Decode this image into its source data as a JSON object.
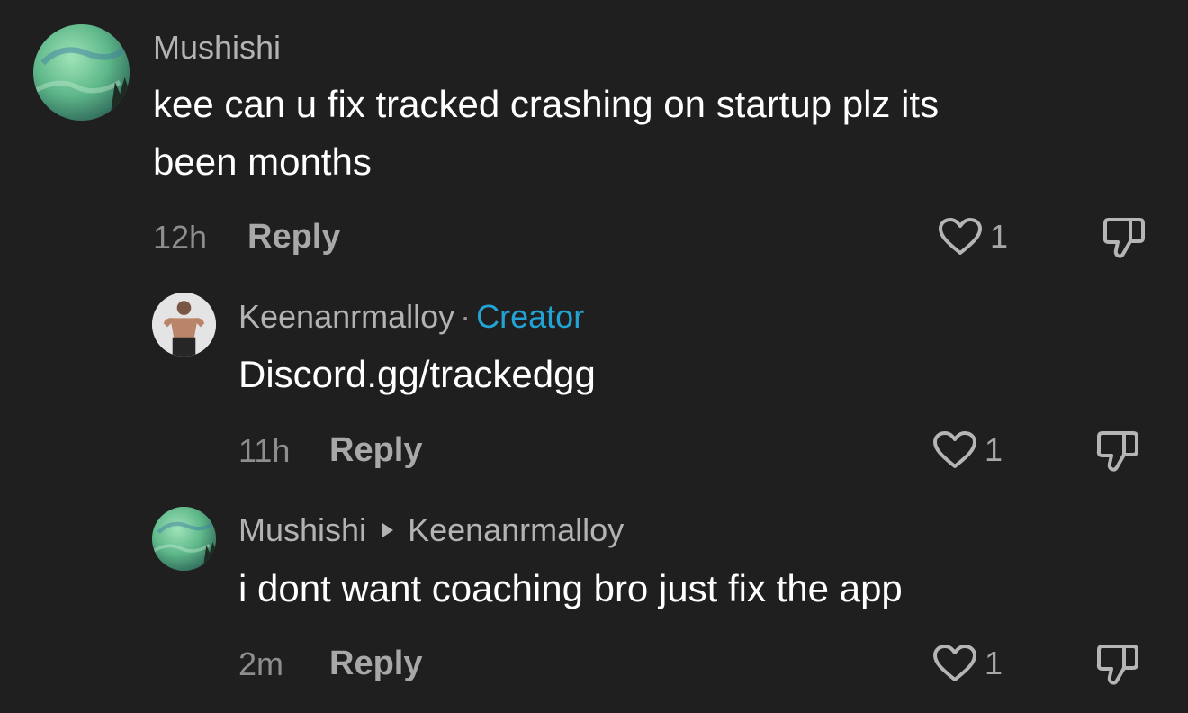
{
  "comments": [
    {
      "username": "Mushishi",
      "text": "kee can u fix tracked crashing on startup plz its\nbeen months",
      "time": "12h",
      "reply_label": "Reply",
      "likes": "1"
    },
    {
      "username": "Keenanrmalloy",
      "separator": "·",
      "badge": "Creator",
      "text": "Discord.gg/trackedgg",
      "time": "11h",
      "reply_label": "Reply",
      "likes": "1"
    },
    {
      "username": "Mushishi",
      "reply_to": "Keenanrmalloy",
      "text": "i dont want coaching bro just fix the app",
      "time": "2m",
      "reply_label": "Reply",
      "likes": "1"
    }
  ],
  "icons": {
    "like": "heart-outline-icon",
    "dislike": "thumbs-down-outline-icon",
    "reply_arrow": "triangle-right-icon"
  },
  "colors": {
    "background": "#1f1f1f",
    "creator_badge": "#23a3d3",
    "text": "#ffffff",
    "muted": "#b3b3b3"
  }
}
